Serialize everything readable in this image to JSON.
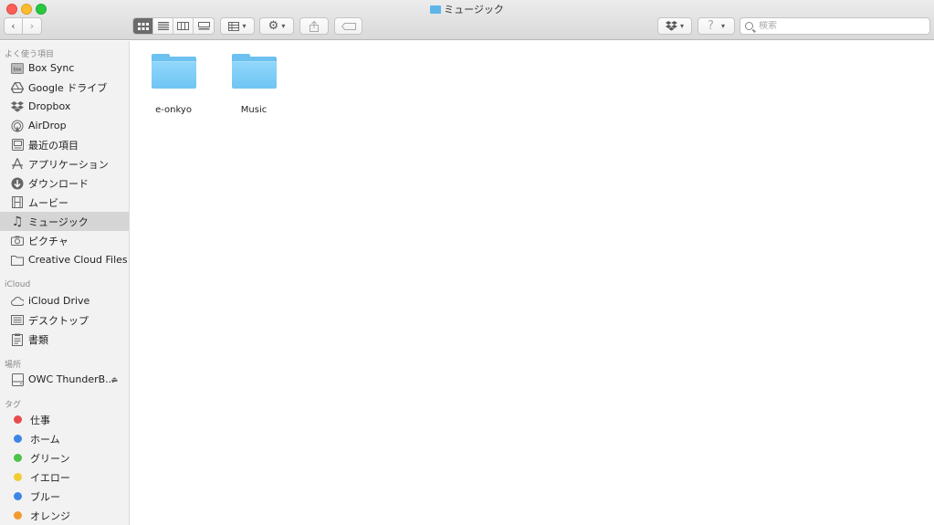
{
  "window": {
    "title": "ミュージック"
  },
  "toolbar": {
    "back_icon": "chevron-left-icon",
    "forward_icon": "chevron-right-icon",
    "view_modes": [
      "icon-view",
      "list-view",
      "column-view",
      "gallery-view"
    ],
    "active_view": "icon-view",
    "search_placeholder": "検索"
  },
  "sidebar": {
    "favorites_title": "よく使う項目",
    "favorites": [
      {
        "label": "Box Sync",
        "icon": "box-icon"
      },
      {
        "label": "Google ドライブ",
        "icon": "google-drive-icon"
      },
      {
        "label": "Dropbox",
        "icon": "dropbox-icon"
      },
      {
        "label": "AirDrop",
        "icon": "airdrop-icon"
      },
      {
        "label": "最近の項目",
        "icon": "recents-icon"
      },
      {
        "label": "アプリケーション",
        "icon": "applications-icon"
      },
      {
        "label": "ダウンロード",
        "icon": "downloads-icon"
      },
      {
        "label": "ムービー",
        "icon": "movies-icon"
      },
      {
        "label": "ミュージック",
        "icon": "music-icon",
        "selected": true
      },
      {
        "label": "ピクチャ",
        "icon": "camera-icon"
      },
      {
        "label": "Creative Cloud Files",
        "icon": "folder-icon"
      }
    ],
    "icloud_title": "iCloud",
    "icloud": [
      {
        "label": "iCloud Drive",
        "icon": "cloud-icon"
      },
      {
        "label": "デスクトップ",
        "icon": "desktop-icon"
      },
      {
        "label": "書類",
        "icon": "documents-icon"
      }
    ],
    "locations_title": "場所",
    "locations": [
      {
        "label": "OWC ThunderB...",
        "icon": "drive-icon"
      }
    ],
    "tags_title": "タグ",
    "tags": [
      {
        "label": "仕事",
        "color": "#e84b4b"
      },
      {
        "label": "ホーム",
        "color": "#3d86e6"
      },
      {
        "label": "グリーン",
        "color": "#4cc34a"
      },
      {
        "label": "イエロー",
        "color": "#f2cc31"
      },
      {
        "label": "ブルー",
        "color": "#3d86e6"
      },
      {
        "label": "オレンジ",
        "color": "#f29a2e"
      }
    ]
  },
  "main": {
    "items": [
      {
        "name": "e-onkyo",
        "icon": "folder-icon"
      },
      {
        "name": "Music",
        "icon": "folder-icon"
      }
    ]
  }
}
